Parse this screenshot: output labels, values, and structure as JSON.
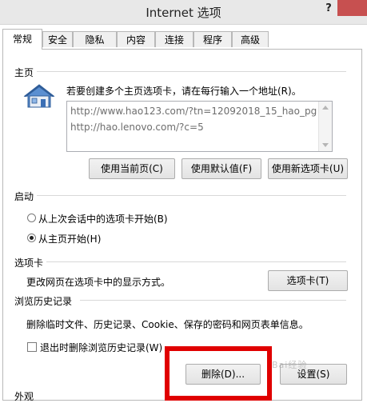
{
  "window": {
    "title": "Internet 选项",
    "help_label": "?"
  },
  "tabs": [
    {
      "label": "常规",
      "active": true
    },
    {
      "label": "安全"
    },
    {
      "label": "隐私"
    },
    {
      "label": "内容"
    },
    {
      "label": "连接"
    },
    {
      "label": "程序"
    },
    {
      "label": "高级"
    }
  ],
  "homepage": {
    "section_label": "主页",
    "instruction": "若要创建多个主页选项卡，请在每行输入一个地址(R)。",
    "urls": [
      "http://www.hao123.com/?tn=12092018_15_hao_pg",
      "http://hao.lenovo.com/?c=5"
    ],
    "btn_current": "使用当前页(C)",
    "btn_default": "使用默认值(F)",
    "btn_newtab": "使用新选项卡(U)"
  },
  "startup": {
    "section_label": "启动",
    "opt_last_session": "从上次会话中的选项卡开始(B)",
    "opt_homepage": "从主页开始(H)",
    "selected": "opt_homepage"
  },
  "tabs_section": {
    "section_label": "选项卡",
    "description": "更改网页在选项卡中的显示方式。",
    "btn": "选项卡(T)"
  },
  "history": {
    "section_label": "浏览历史记录",
    "description": "删除临时文件、历史记录、Cookie、保存的密码和网页表单信息。",
    "checkbox_label": "退出时删除浏览历史记录(W)",
    "checkbox_checked": false,
    "btn_delete": "删除(D)...",
    "btn_settings": "设置(S)"
  },
  "appearance": {
    "section_label": "外观"
  },
  "watermark": "Bai经验"
}
